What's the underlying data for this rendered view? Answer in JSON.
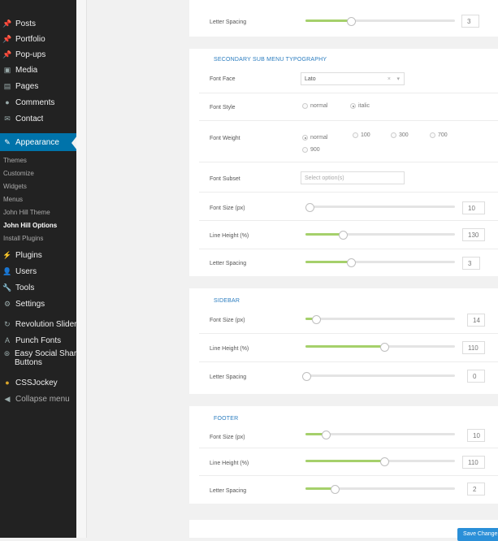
{
  "sidebar": {
    "posts": "Posts",
    "portfolio": "Portfolio",
    "popups": "Pop-ups",
    "media": "Media",
    "pages": "Pages",
    "comments": "Comments",
    "contact": "Contact",
    "appearance": "Appearance",
    "sub": [
      "Themes",
      "Customize",
      "Widgets",
      "Menus",
      "John Hill Theme",
      "John Hill Options",
      "Install Plugins"
    ],
    "plugins": "Plugins",
    "users": "Users",
    "tools": "Tools",
    "settings": "Settings",
    "revolution_slider": "Revolution Slider",
    "punch_fonts": "Punch Fonts",
    "easy_social_1": "Easy Social Share",
    "easy_social_2": "Buttons",
    "cssjockey": "CSSJockey",
    "collapse": "Collapse menu"
  },
  "top_row": {
    "label": "Letter Spacing",
    "value": "3",
    "fill": 0.2
  },
  "secondary": {
    "title": "SECONDARY SUB MENU TYPOGRAPHY",
    "font_face_label": "Font Face",
    "font_face_value": "Lato",
    "font_style_label": "Font Style",
    "style_normal": "normal",
    "style_italic": "italic",
    "font_weight_label": "Font Weight",
    "w_normal": "normal",
    "w_100": "100",
    "w_300": "300",
    "w_700": "700",
    "w_900": "900",
    "font_subset_label": "Font Subset",
    "font_subset_placeholder": "Select option(s)",
    "font_size_label": "Font Size (px)",
    "font_size_value": "10",
    "font_size_fill": 0.0,
    "line_height_label": "Line Height (%)",
    "line_height_value": "130",
    "line_height_fill": 0.2,
    "letter_spacing_label": "Letter Spacing",
    "letter_spacing_value": "3",
    "letter_spacing_fill": 0.2
  },
  "sidebar_section": {
    "title": "SIDEBAR",
    "font_size_label": "Font Size (px)",
    "font_size_value": "14",
    "font_size_fill": 0.05,
    "line_height_label": "Line Height (%)",
    "line_height_value": "110",
    "line_height_fill": 0.5,
    "letter_spacing_label": "Letter Spacing",
    "letter_spacing_value": "0",
    "letter_spacing_fill": 0.0
  },
  "footer_section": {
    "title": "FOOTER",
    "font_size_label": "Font Size (px)",
    "font_size_value": "10",
    "font_size_fill": 0.1,
    "line_height_label": "Line Height (%)",
    "line_height_value": "110",
    "line_height_fill": 0.5,
    "letter_spacing_label": "Letter Spacing",
    "letter_spacing_value": "2",
    "letter_spacing_fill": 0.18
  },
  "save_label": "Save Changes",
  "colors": {
    "accent": "#0073aa",
    "slider": "#a5d06b",
    "section_title": "#2a7cbf"
  }
}
